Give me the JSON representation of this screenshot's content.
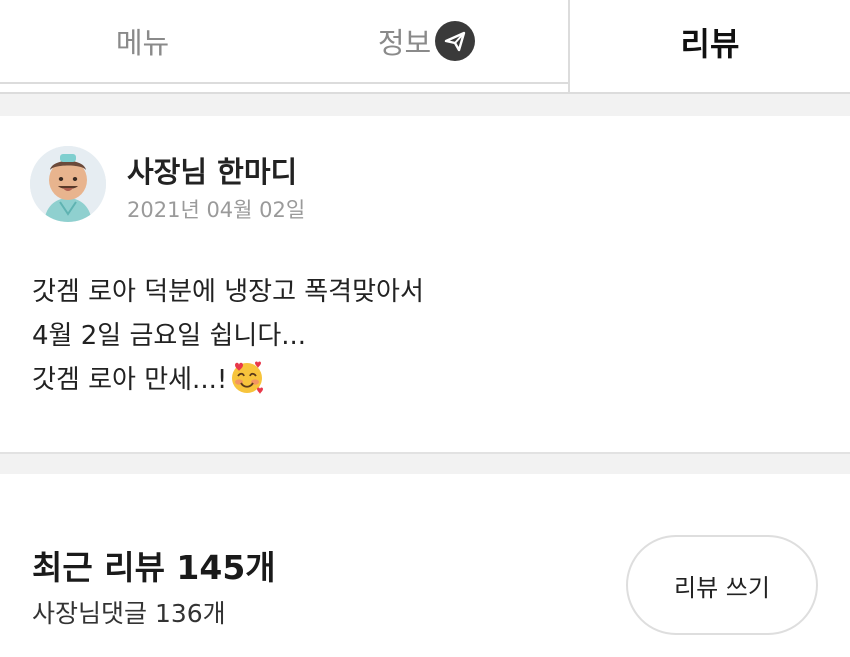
{
  "tabs": {
    "menu": "메뉴",
    "info": "정보",
    "review": "리뷰",
    "info_badge_icon": "send-icon"
  },
  "notice": {
    "title": "사장님 한마디",
    "date": "2021년 04월 02일",
    "lines": [
      "갓겜 로아 덕분에 냉장고 폭격맞아서",
      "4월 2일 금요일 쉽니다...",
      "갓겜 로아 만세...!"
    ],
    "emoji": "smiling-face-with-hearts"
  },
  "reviews": {
    "heading": "최근 리뷰 145개",
    "owner_replies": "사장님댓글 136개",
    "write_button": "리뷰 쓰기"
  },
  "colors": {
    "divider": "#dcdcdc",
    "gap_bg": "#f2f2f2",
    "muted_text": "#8a8a8a",
    "date_text": "#9a9a9a"
  }
}
